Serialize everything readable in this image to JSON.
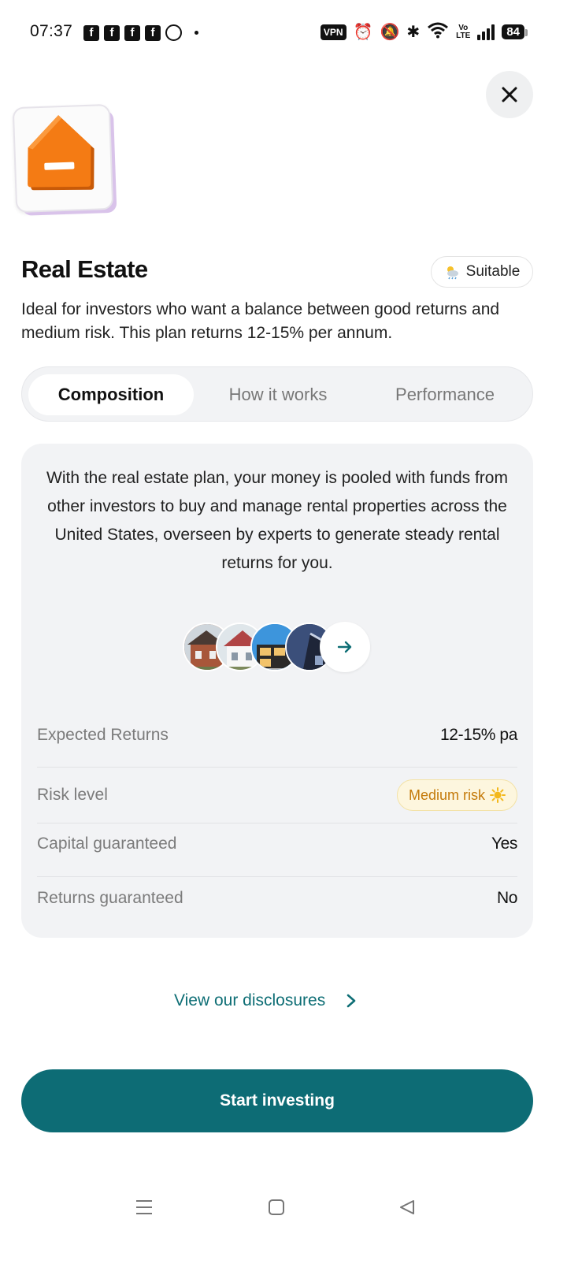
{
  "status_bar": {
    "time": "07:37",
    "left_icons": [
      "facebook-icon",
      "facebook-icon",
      "facebook-icon",
      "facebook-icon",
      "whatsapp-icon"
    ],
    "vpn_label": "VPN",
    "volte_top": "Vo",
    "volte_bottom": "LTE",
    "battery": "84"
  },
  "hero": {
    "icon": "house-icon",
    "accent_color": "#f47b14"
  },
  "plan": {
    "title": "Real Estate",
    "badge": "Suitable",
    "badge_icon": "sun-cloud-icon",
    "description": "Ideal for investors who want a balance between good returns and medium risk. This plan returns 12-15% per annum."
  },
  "tabs": [
    {
      "label": "Composition",
      "active": true
    },
    {
      "label": "How it works",
      "active": false
    },
    {
      "label": "Performance",
      "active": false
    }
  ],
  "composition": {
    "text": "With the real estate plan, your money is pooled with funds from other investors to buy and manage rental properties across the United States, overseen by experts to generate steady rental returns for you.",
    "property_thumbnails": [
      "brick-house",
      "white-house",
      "modern-house",
      "tower-building"
    ]
  },
  "details": [
    {
      "label": "Expected Returns",
      "value": "12-15% pa"
    },
    {
      "label": "Risk level",
      "value": "Medium risk",
      "badge_icon": "sun-icon"
    },
    {
      "label": "Capital guaranteed",
      "value": "Yes"
    },
    {
      "label": "Returns guaranteed",
      "value": "No"
    }
  ],
  "disclosures_link": "View our disclosures",
  "cta": "Start investing",
  "colors": {
    "primary": "#0d6c75",
    "risk_text": "#c47a0a",
    "risk_bg": "#fdf6de",
    "card_bg": "#f2f3f5"
  }
}
